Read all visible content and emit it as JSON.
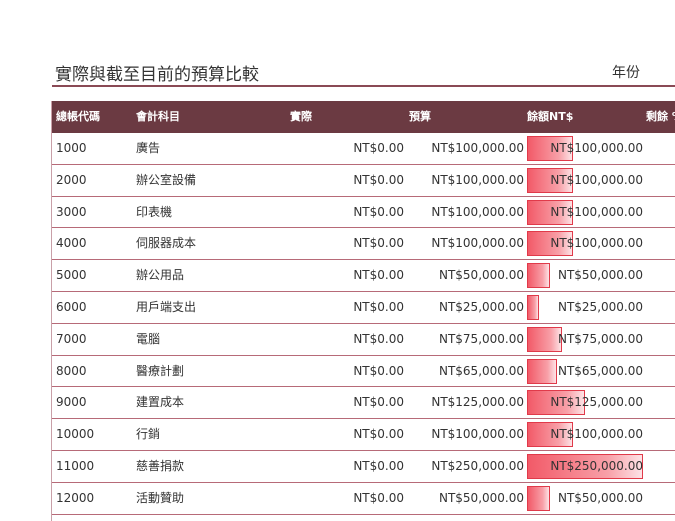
{
  "page": {
    "title": "實際與截至目前的預算比較",
    "year_label": "年份"
  },
  "colors": {
    "header_bg": "#6b3a42",
    "row_border": "#b76a78",
    "bar_red": "#f25a68"
  },
  "table": {
    "headers": {
      "code": "總帳代碼",
      "account": "會計科目",
      "actual": "實際",
      "budget": "預算",
      "remaining": "餘額NT$",
      "pct": "剩餘 %"
    },
    "rows": [
      {
        "code": "1000",
        "account": "廣告",
        "actual": "NT$0.00",
        "budget": "NT$100,000.00",
        "remaining": "NT$100,000.00",
        "remaining_value": 100000
      },
      {
        "code": "2000",
        "account": "辦公室設備",
        "actual": "NT$0.00",
        "budget": "NT$100,000.00",
        "remaining": "NT$100,000.00",
        "remaining_value": 100000
      },
      {
        "code": "3000",
        "account": "印表機",
        "actual": "NT$0.00",
        "budget": "NT$100,000.00",
        "remaining": "NT$100,000.00",
        "remaining_value": 100000
      },
      {
        "code": "4000",
        "account": "伺服器成本",
        "actual": "NT$0.00",
        "budget": "NT$100,000.00",
        "remaining": "NT$100,000.00",
        "remaining_value": 100000
      },
      {
        "code": "5000",
        "account": "辦公用品",
        "actual": "NT$0.00",
        "budget": "NT$50,000.00",
        "remaining": "NT$50,000.00",
        "remaining_value": 50000
      },
      {
        "code": "6000",
        "account": "用戶端支出",
        "actual": "NT$0.00",
        "budget": "NT$25,000.00",
        "remaining": "NT$25,000.00",
        "remaining_value": 25000
      },
      {
        "code": "7000",
        "account": "電腦",
        "actual": "NT$0.00",
        "budget": "NT$75,000.00",
        "remaining": "NT$75,000.00",
        "remaining_value": 75000
      },
      {
        "code": "8000",
        "account": "醫療計劃",
        "actual": "NT$0.00",
        "budget": "NT$65,000.00",
        "remaining": "NT$65,000.00",
        "remaining_value": 65000
      },
      {
        "code": "9000",
        "account": "建置成本",
        "actual": "NT$0.00",
        "budget": "NT$125,000.00",
        "remaining": "NT$125,000.00",
        "remaining_value": 125000
      },
      {
        "code": "10000",
        "account": "行銷",
        "actual": "NT$0.00",
        "budget": "NT$100,000.00",
        "remaining": "NT$100,000.00",
        "remaining_value": 100000
      },
      {
        "code": "11000",
        "account": "慈善捐款",
        "actual": "NT$0.00",
        "budget": "NT$250,000.00",
        "remaining": "NT$250,000.00",
        "remaining_value": 250000
      },
      {
        "code": "12000",
        "account": "活動贊助",
        "actual": "NT$0.00",
        "budget": "NT$50,000.00",
        "remaining": "NT$50,000.00",
        "remaining_value": 50000
      }
    ]
  }
}
